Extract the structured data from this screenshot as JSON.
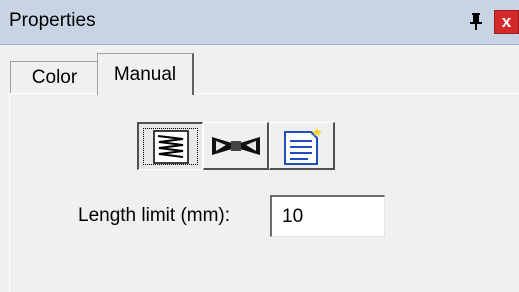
{
  "panel": {
    "title": "Properties",
    "pin_icon": "pin-icon",
    "close_label": "x"
  },
  "tabs": [
    {
      "label": "Color",
      "selected": false
    },
    {
      "label": "Manual",
      "selected": true
    }
  ],
  "toolbar": {
    "buttons": [
      {
        "icon": "spring-icon",
        "pressed": true
      },
      {
        "icon": "bowtie-icon",
        "pressed": false
      },
      {
        "icon": "document-new-icon",
        "pressed": false
      }
    ]
  },
  "form": {
    "length_label": "Length limit (mm):",
    "length_value": "10"
  },
  "colors": {
    "titlebar": "#c8d4e4",
    "close": "#d42a2a",
    "doc_blue": "#1f4fbf"
  }
}
